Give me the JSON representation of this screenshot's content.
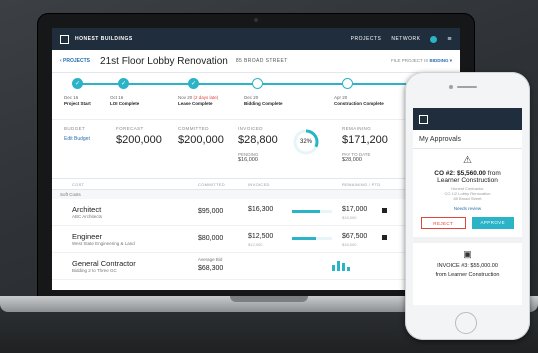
{
  "app": {
    "brand": "HONEST BUILDINGS",
    "nav": [
      "PROJECTS",
      "NETWORK"
    ],
    "menu_glyph": "≡"
  },
  "project": {
    "back_label": "‹ PROJECTS",
    "title": "21st Floor Lobby Renovation",
    "address": "85 BROAD STREET",
    "status_label": "FILE PROJECT IS",
    "status_value": "BIDDING ▾"
  },
  "timeline": [
    {
      "date": "Dec 16",
      "label": "Project Start",
      "done": true,
      "late": ""
    },
    {
      "date": "Oct 16",
      "label": "LOI Complete",
      "done": true,
      "late": ""
    },
    {
      "date": "Nov 20",
      "label": "Lease Complete",
      "done": true,
      "late": "(2 days late)"
    },
    {
      "date": "Dec 20",
      "label": "Bidding Complete",
      "done": false,
      "late": ""
    },
    {
      "date": "Apr 20",
      "label": "Construction Complete",
      "done": false,
      "late": ""
    }
  ],
  "kpis": {
    "budget_label": "BUDGET",
    "budget_link": "Edit Budget",
    "forecast_label": "FORECAST",
    "forecast_value": "$200,000",
    "committed_label": "COMMITTED",
    "committed_value": "$200,000",
    "invoiced_label": "INVOICED",
    "invoiced_value": "$28,800",
    "invoiced_pct": "32%",
    "pending_label": "PENDING",
    "pending_value": "$16,000",
    "remaining_label": "REMAINING",
    "remaining_value": "$171,200",
    "pay_to_date_label": "PAY TO DATE",
    "pay_to_date_value": "$28,000"
  },
  "table": {
    "headers": [
      "COST",
      "COMMITTED",
      "INVOICED",
      "REMAINING / PTD"
    ],
    "group": "Soft Costs",
    "rows": [
      {
        "name": "Architect",
        "sub": "ABC Architects",
        "committed_label": "",
        "committed": "$95,000",
        "invoiced": "$16,300",
        "invoiced_sub": "",
        "remaining": "$17,000",
        "remaining_sub": "$18,000",
        "fill": 0.7
      },
      {
        "name": "Engineer",
        "sub": "West State Engineering & Land",
        "committed_label": "",
        "committed": "$80,000",
        "invoiced": "$12,500",
        "invoiced_sub": "$12,000",
        "remaining": "$67,500",
        "remaining_sub": "$18,000",
        "fill": 0.6
      },
      {
        "name": "General Contractor",
        "sub": "Bidding 2 to Three GC",
        "committed_label": "Average Bid",
        "committed": "$68,300",
        "invoiced": "",
        "invoiced_sub": "",
        "remaining": "",
        "remaining_sub": "",
        "fill": 0
      }
    ]
  },
  "phone": {
    "section_title": "My Approvals",
    "card": {
      "title_prefix": "CO #2: $5,560.00",
      "title_suffix": "from",
      "company": "Learner Construction",
      "sub1": "Honest Contractor",
      "sub2": "CO 1/2 Lobby Renovation",
      "sub3": "85 Broad Street",
      "link": "Needs review",
      "reject": "REJECT",
      "approve": "APPROVE"
    },
    "card2": {
      "title": "INVOICE #3: $55,000.00",
      "company": "from Learner Construction"
    }
  },
  "colors": {
    "accent": "#2bb3c7",
    "header": "#1f2d3d",
    "link": "#2a6fb0",
    "danger": "#e0463e"
  }
}
